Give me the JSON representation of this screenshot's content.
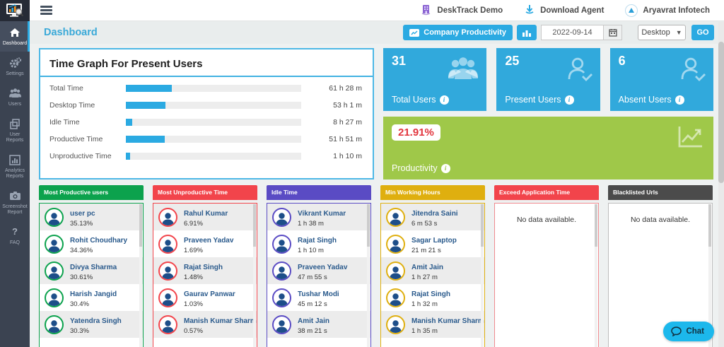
{
  "topbar": {
    "links": [
      {
        "label": "DeskTrack Demo",
        "icon": "building-icon"
      },
      {
        "label": "Download Agent",
        "icon": "download-icon"
      },
      {
        "label": "Aryavrat Infotech",
        "icon": "triangle-icon"
      }
    ]
  },
  "sidebar": {
    "items": [
      {
        "label": "Dashboard",
        "active": true
      },
      {
        "label": "Settings",
        "active": false
      },
      {
        "label": "Users",
        "active": false
      },
      {
        "label": "User Reports",
        "active": false
      },
      {
        "label": "Analytics Reports",
        "active": false
      },
      {
        "label": "Screenshot Report",
        "active": false
      },
      {
        "label": "FAQ",
        "active": false
      }
    ]
  },
  "header": {
    "title": "Dashboard",
    "company_productivity_label": "Company Productivity",
    "date_value": "2022-09-14",
    "device_value": "Desktop",
    "go_label": "GO"
  },
  "time_graph": {
    "title": "Time Graph For Present Users",
    "rows": [
      {
        "label": "Total Time",
        "value": "61 h 28 m",
        "pct": 26.1
      },
      {
        "label": "Desktop Time",
        "value": "53 h 1 m",
        "pct": 22.4
      },
      {
        "label": "Idle Time",
        "value": "8 h 27 m",
        "pct": 3.8
      },
      {
        "label": "Productive Time",
        "value": "51 h 51 m",
        "pct": 22.1
      },
      {
        "label": "Unproductive Time",
        "value": "1 h 10 m",
        "pct": 2.5
      }
    ]
  },
  "stats": [
    {
      "value": "31",
      "label": "Total Users"
    },
    {
      "value": "25",
      "label": "Present Users"
    },
    {
      "value": "6",
      "label": "Absent Users"
    }
  ],
  "productivity": {
    "value": "21.91%",
    "label": "Productivity"
  },
  "columns": [
    {
      "title": "Most Productive users",
      "color": "#0ca24d",
      "items": [
        {
          "name": "user pc",
          "value": "35.13%"
        },
        {
          "name": "Rohit Choudhary",
          "value": "34.36%"
        },
        {
          "name": "Divya Sharma",
          "value": "30.61%"
        },
        {
          "name": "Harish Jangid",
          "value": "30.4%"
        },
        {
          "name": "Yatendra Singh",
          "value": "30.3%"
        }
      ]
    },
    {
      "title": "Most Unproductive Time",
      "color": "#f2444b",
      "items": [
        {
          "name": "Rahul Kumar",
          "value": "6.91%"
        },
        {
          "name": "Praveen Yadav",
          "value": "1.69%"
        },
        {
          "name": "Rajat Singh",
          "value": "1.48%"
        },
        {
          "name": "Gaurav Panwar",
          "value": "1.03%"
        },
        {
          "name": "Manish Kumar Sharma",
          "value": "0.57%"
        }
      ]
    },
    {
      "title": "Idle Time",
      "color": "#5a4bc4",
      "items": [
        {
          "name": "Vikrant Kumar",
          "value": "1 h 38 m"
        },
        {
          "name": "Rajat Singh",
          "value": "1 h 10 m"
        },
        {
          "name": "Praveen Yadav",
          "value": "47 m 55 s"
        },
        {
          "name": "Tushar Modi",
          "value": "45 m 12 s"
        },
        {
          "name": "Amit Jain",
          "value": "38 m 21 s"
        }
      ]
    },
    {
      "title": "Min Working Hours",
      "color": "#dfaf0f",
      "items": [
        {
          "name": "Jitendra Saini",
          "value": "6 m 53 s"
        },
        {
          "name": "Sagar Laptop",
          "value": "21 m 21 s"
        },
        {
          "name": "Amit Jain",
          "value": "1 h 27 m"
        },
        {
          "name": "Rajat Singh",
          "value": "1 h 32 m"
        },
        {
          "name": "Manish Kumar Sharma",
          "value": "1 h 35 m"
        }
      ]
    },
    {
      "title": "Exceed Application Time",
      "color": "#f2444b",
      "border_color": "#ef8a8f",
      "empty_text": "No data available."
    },
    {
      "title": "Blacklisted Urls",
      "color": "#4b4b4b",
      "border_color": "#bdbdbd",
      "empty_text": "No data available."
    }
  ],
  "chat": {
    "label": "Chat"
  },
  "colors": {
    "accent_cyan": "#2baae2",
    "stat_blue": "#31a9dc",
    "productivity_green": "#9fc849",
    "productivity_value_red": "#e2353d",
    "sidebar_dark": "#3b4351"
  }
}
